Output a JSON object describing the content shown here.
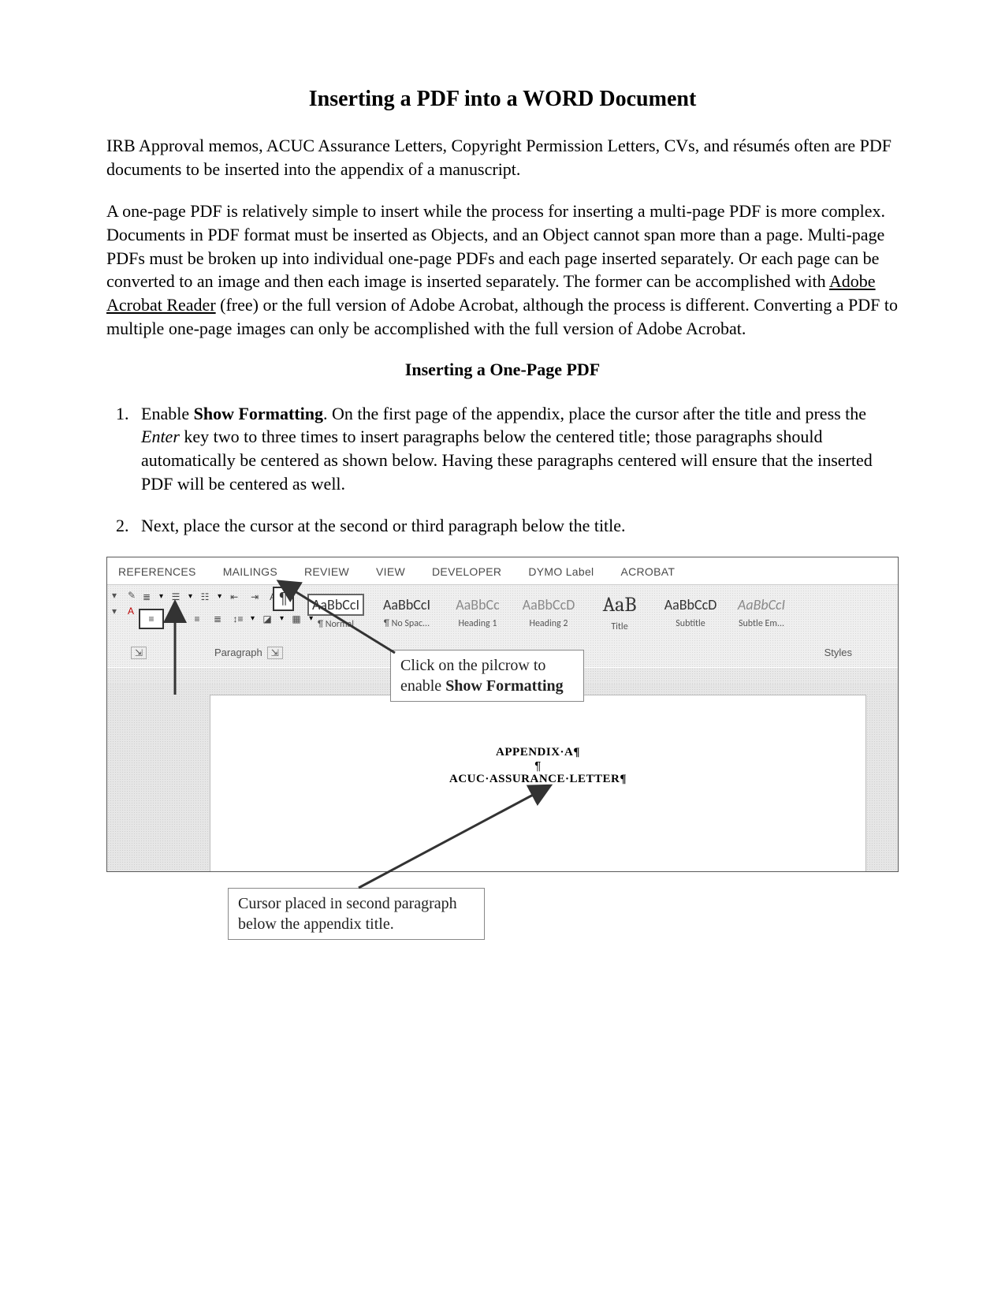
{
  "title": "Inserting a PDF into a WORD Document",
  "intro1": "IRB Approval memos, ACUC Assurance Letters, Copyright Permission Letters, CVs, and résumés often are PDF documents to be inserted into the appendix of a manuscript.",
  "intro2_a": "A one-page PDF is relatively simple to insert while the process for inserting a multi-page PDF is more complex. Documents in PDF format must be inserted as Objects, and an Object cannot span more than a page. Multi-page PDFs must be broken up into individual one-page PDFs and each page inserted separately. Or each page can be converted to an image and then each image is inserted separately. The former can be accomplished with ",
  "intro2_link": "Adobe Acrobat Reader",
  "intro2_b": " (free) or the full version of Adobe Acrobat, although the process is different. Converting a PDF to multiple one-page images can only be accomplished with the full version of Adobe Acrobat.",
  "subhead": "Inserting a One-Page PDF",
  "step1_a": "Enable ",
  "step1_bold": "Show Formatting",
  "step1_b": ". On the first page of the appendix, place the cursor after the title and press the ",
  "step1_italic": "Enter",
  "step1_c": " key two to three times to insert paragraphs below the centered title; those paragraphs should automatically be centered as shown below. Having these paragraphs centered will ensure that the inserted PDF will be centered as well.",
  "step2": "Next, place the cursor at the second or third paragraph below the title.",
  "ribbon": {
    "tabs": [
      "REFERENCES",
      "MAILINGS",
      "REVIEW",
      "VIEW",
      "DEVELOPER",
      "DYMO Label",
      "ACROBAT"
    ],
    "paragraph_label": "Paragraph",
    "font_dialog": "⤢",
    "styles_label": "Styles",
    "styles": [
      {
        "sample": "AaBbCcI",
        "label": "¶ Normal",
        "cls": "selected"
      },
      {
        "sample": "AaBbCcI",
        "label": "¶ No Spac..."
      },
      {
        "sample": "AaBbCc",
        "label": "Heading 1",
        "cls": "sg-heading"
      },
      {
        "sample": "AaBbCcD",
        "label": "Heading 2",
        "cls": "sg-heading"
      },
      {
        "sample": "AaB",
        "label": "Title",
        "cls": "sg-title"
      },
      {
        "sample": "AaBbCcD",
        "label": "Subtitle"
      },
      {
        "sample": "AaBbCcI",
        "label": "Subtle Em...",
        "cls": "sg-subtle"
      }
    ]
  },
  "doc": {
    "line1": "APPENDIX·A¶",
    "line2": "¶",
    "line3": "ACUC·ASSURANCE·LETTER¶",
    "line4": "¶"
  },
  "callout1_a": "Click on the pilcrow to enable ",
  "callout1_b": "Show Formatting",
  "callout2": "Cursor placed in second paragraph below the appendix title."
}
